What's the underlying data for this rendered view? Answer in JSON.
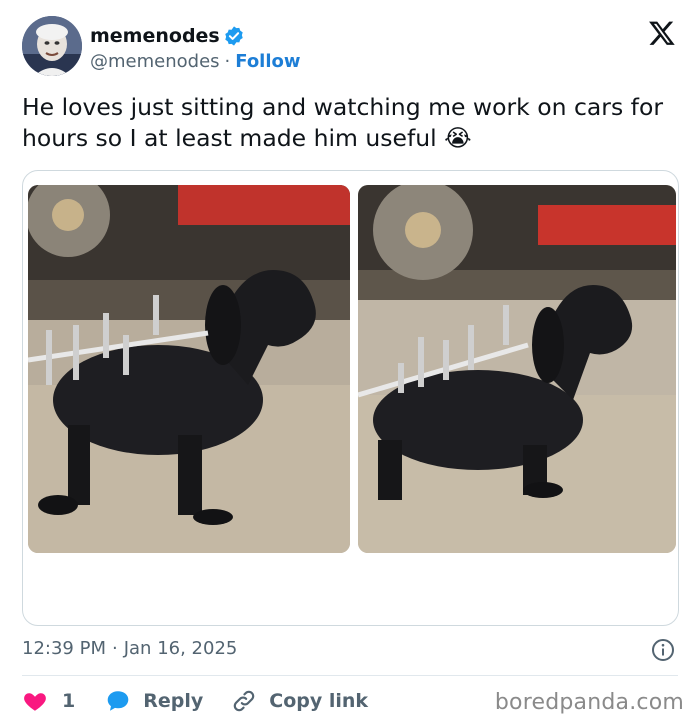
{
  "author": {
    "display_name": "memenodes",
    "handle": "@memenodes",
    "separator": "·",
    "follow_label": "Follow",
    "verified_color": "#1d9bf0"
  },
  "tweet": {
    "text": "He loves just sitting and watching me work on cars for hours so I at least made him useful 😭"
  },
  "media": {
    "photos": [
      {
        "subject": "dachshund in black coat with wrenches tucked in strap"
      },
      {
        "subject": "dachshund in black coat with wrenches tucked in strap"
      }
    ]
  },
  "meta": {
    "time": "12:39 PM",
    "separator": "·",
    "date": "Jan 16, 2025"
  },
  "actions": {
    "like_count": "1",
    "reply_label": "Reply",
    "copy_link_label": "Copy link",
    "like_color": "#f91880",
    "reply_color": "#1d9bf0"
  },
  "watermark": "boredpanda.com"
}
